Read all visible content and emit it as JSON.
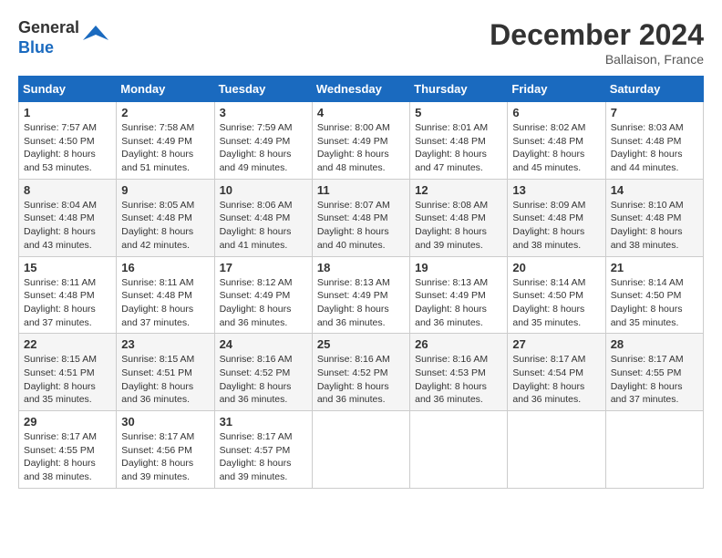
{
  "logo": {
    "line1": "General",
    "line2": "Blue"
  },
  "title": "December 2024",
  "location": "Ballaison, France",
  "days_header": [
    "Sunday",
    "Monday",
    "Tuesday",
    "Wednesday",
    "Thursday",
    "Friday",
    "Saturday"
  ],
  "weeks": [
    [
      {
        "day": "1",
        "sunrise": "7:57 AM",
        "sunset": "4:50 PM",
        "daylight": "8 hours and 53 minutes."
      },
      {
        "day": "2",
        "sunrise": "7:58 AM",
        "sunset": "4:49 PM",
        "daylight": "8 hours and 51 minutes."
      },
      {
        "day": "3",
        "sunrise": "7:59 AM",
        "sunset": "4:49 PM",
        "daylight": "8 hours and 49 minutes."
      },
      {
        "day": "4",
        "sunrise": "8:00 AM",
        "sunset": "4:49 PM",
        "daylight": "8 hours and 48 minutes."
      },
      {
        "day": "5",
        "sunrise": "8:01 AM",
        "sunset": "4:48 PM",
        "daylight": "8 hours and 47 minutes."
      },
      {
        "day": "6",
        "sunrise": "8:02 AM",
        "sunset": "4:48 PM",
        "daylight": "8 hours and 45 minutes."
      },
      {
        "day": "7",
        "sunrise": "8:03 AM",
        "sunset": "4:48 PM",
        "daylight": "8 hours and 44 minutes."
      }
    ],
    [
      {
        "day": "8",
        "sunrise": "8:04 AM",
        "sunset": "4:48 PM",
        "daylight": "8 hours and 43 minutes."
      },
      {
        "day": "9",
        "sunrise": "8:05 AM",
        "sunset": "4:48 PM",
        "daylight": "8 hours and 42 minutes."
      },
      {
        "day": "10",
        "sunrise": "8:06 AM",
        "sunset": "4:48 PM",
        "daylight": "8 hours and 41 minutes."
      },
      {
        "day": "11",
        "sunrise": "8:07 AM",
        "sunset": "4:48 PM",
        "daylight": "8 hours and 40 minutes."
      },
      {
        "day": "12",
        "sunrise": "8:08 AM",
        "sunset": "4:48 PM",
        "daylight": "8 hours and 39 minutes."
      },
      {
        "day": "13",
        "sunrise": "8:09 AM",
        "sunset": "4:48 PM",
        "daylight": "8 hours and 38 minutes."
      },
      {
        "day": "14",
        "sunrise": "8:10 AM",
        "sunset": "4:48 PM",
        "daylight": "8 hours and 38 minutes."
      }
    ],
    [
      {
        "day": "15",
        "sunrise": "8:11 AM",
        "sunset": "4:48 PM",
        "daylight": "8 hours and 37 minutes."
      },
      {
        "day": "16",
        "sunrise": "8:11 AM",
        "sunset": "4:48 PM",
        "daylight": "8 hours and 37 minutes."
      },
      {
        "day": "17",
        "sunrise": "8:12 AM",
        "sunset": "4:49 PM",
        "daylight": "8 hours and 36 minutes."
      },
      {
        "day": "18",
        "sunrise": "8:13 AM",
        "sunset": "4:49 PM",
        "daylight": "8 hours and 36 minutes."
      },
      {
        "day": "19",
        "sunrise": "8:13 AM",
        "sunset": "4:49 PM",
        "daylight": "8 hours and 36 minutes."
      },
      {
        "day": "20",
        "sunrise": "8:14 AM",
        "sunset": "4:50 PM",
        "daylight": "8 hours and 35 minutes."
      },
      {
        "day": "21",
        "sunrise": "8:14 AM",
        "sunset": "4:50 PM",
        "daylight": "8 hours and 35 minutes."
      }
    ],
    [
      {
        "day": "22",
        "sunrise": "8:15 AM",
        "sunset": "4:51 PM",
        "daylight": "8 hours and 35 minutes."
      },
      {
        "day": "23",
        "sunrise": "8:15 AM",
        "sunset": "4:51 PM",
        "daylight": "8 hours and 36 minutes."
      },
      {
        "day": "24",
        "sunrise": "8:16 AM",
        "sunset": "4:52 PM",
        "daylight": "8 hours and 36 minutes."
      },
      {
        "day": "25",
        "sunrise": "8:16 AM",
        "sunset": "4:52 PM",
        "daylight": "8 hours and 36 minutes."
      },
      {
        "day": "26",
        "sunrise": "8:16 AM",
        "sunset": "4:53 PM",
        "daylight": "8 hours and 36 minutes."
      },
      {
        "day": "27",
        "sunrise": "8:17 AM",
        "sunset": "4:54 PM",
        "daylight": "8 hours and 36 minutes."
      },
      {
        "day": "28",
        "sunrise": "8:17 AM",
        "sunset": "4:55 PM",
        "daylight": "8 hours and 37 minutes."
      }
    ],
    [
      {
        "day": "29",
        "sunrise": "8:17 AM",
        "sunset": "4:55 PM",
        "daylight": "8 hours and 38 minutes."
      },
      {
        "day": "30",
        "sunrise": "8:17 AM",
        "sunset": "4:56 PM",
        "daylight": "8 hours and 39 minutes."
      },
      {
        "day": "31",
        "sunrise": "8:17 AM",
        "sunset": "4:57 PM",
        "daylight": "8 hours and 39 minutes."
      },
      null,
      null,
      null,
      null
    ]
  ]
}
